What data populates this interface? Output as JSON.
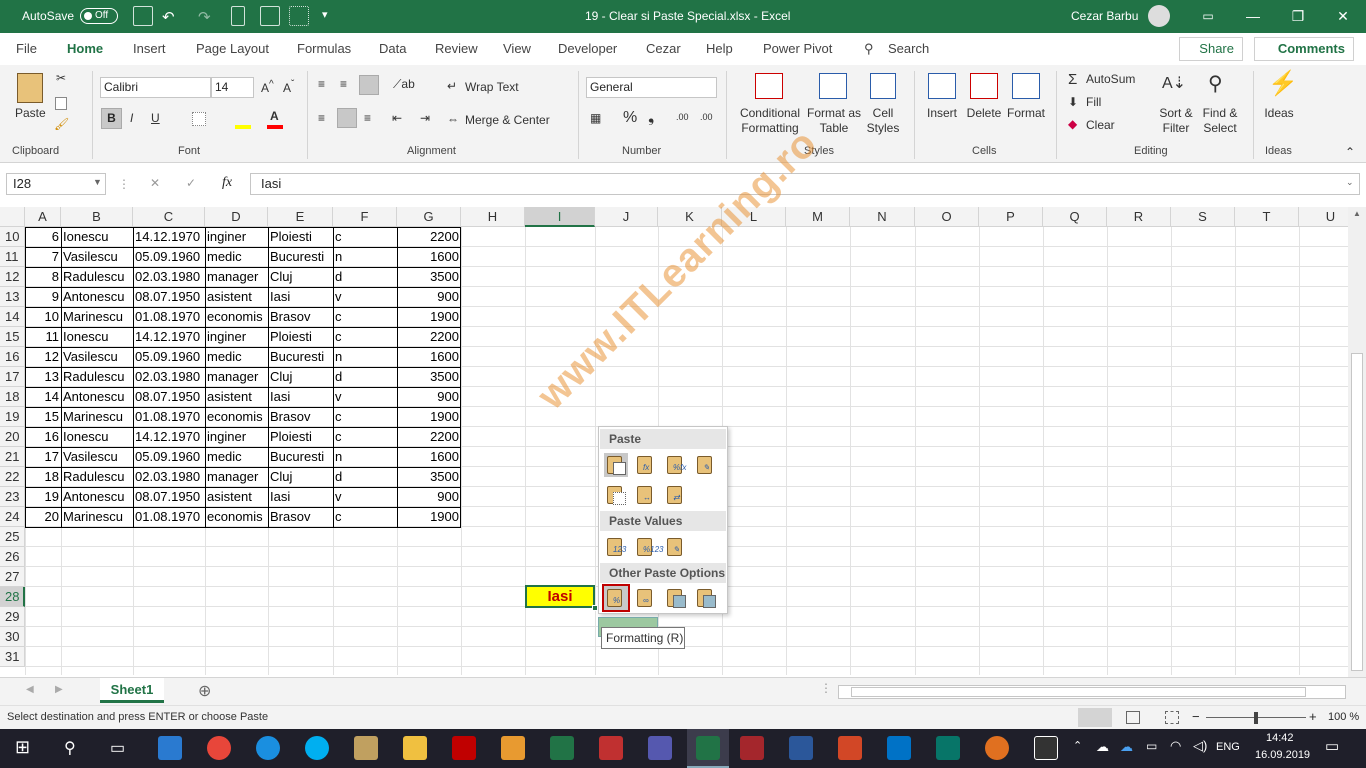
{
  "titlebar": {
    "autosave": "AutoSave",
    "autosave_state": "Off",
    "title": "19 - Clear si Paste Special.xlsx  -  Excel",
    "user": "Cezar Barbu"
  },
  "tabs": [
    "File",
    "Home",
    "Insert",
    "Page Layout",
    "Formulas",
    "Data",
    "Review",
    "View",
    "Developer",
    "Cezar",
    "Help",
    "Power Pivot"
  ],
  "search": "Search",
  "share": "Share",
  "comments": "Comments",
  "ribbon": {
    "paste": "Paste",
    "clipboard": "Clipboard",
    "font_name": "Calibri",
    "font_size": "14",
    "font": "Font",
    "wrap_text": "Wrap Text",
    "merge_center": "Merge & Center",
    "alignment": "Alignment",
    "number_format": "General",
    "number": "Number",
    "conditional": "Conditional",
    "formatting": "Formatting",
    "format_as": "Format as",
    "table": "Table",
    "cell": "Cell",
    "styles_btn": "Styles",
    "styles": "Styles",
    "insert": "Insert",
    "delete": "Delete",
    "format": "Format",
    "cells": "Cells",
    "autosum": "AutoSum",
    "fill": "Fill",
    "clear": "Clear",
    "sort": "Sort &",
    "filter": "Filter",
    "find": "Find &",
    "select": "Select",
    "editing": "Editing",
    "ideas_btn": "Ideas",
    "ideas": "Ideas"
  },
  "namebox": "I28",
  "formula": "Iasi",
  "columns": [
    "A",
    "B",
    "C",
    "D",
    "E",
    "F",
    "G",
    "H",
    "I",
    "J",
    "K",
    "L",
    "M",
    "N",
    "O",
    "P",
    "Q",
    "R",
    "S",
    "T",
    "U"
  ],
  "rows": [
    {
      "n": "10",
      "a": "6",
      "b": "Ionescu",
      "c": "14.12.1970",
      "d": "inginer",
      "e": "Ploiesti",
      "f": "c",
      "g": "2200"
    },
    {
      "n": "11",
      "a": "7",
      "b": "Vasilescu",
      "c": "05.09.1960",
      "d": "medic",
      "e": "Bucuresti",
      "f": "n",
      "g": "1600"
    },
    {
      "n": "12",
      "a": "8",
      "b": "Radulescu",
      "c": "02.03.1980",
      "d": "manager",
      "e": "Cluj",
      "f": "d",
      "g": "3500"
    },
    {
      "n": "13",
      "a": "9",
      "b": "Antonescu",
      "c": "08.07.1950",
      "d": "asistent",
      "e": "Iasi",
      "f": "v",
      "g": "900"
    },
    {
      "n": "14",
      "a": "10",
      "b": "Marinescu",
      "c": "01.08.1970",
      "d": "economis",
      "e": "Brasov",
      "f": "c",
      "g": "1900"
    },
    {
      "n": "15",
      "a": "11",
      "b": "Ionescu",
      "c": "14.12.1970",
      "d": "inginer",
      "e": "Ploiesti",
      "f": "c",
      "g": "2200"
    },
    {
      "n": "16",
      "a": "12",
      "b": "Vasilescu",
      "c": "05.09.1960",
      "d": "medic",
      "e": "Bucuresti",
      "f": "n",
      "g": "1600"
    },
    {
      "n": "17",
      "a": "13",
      "b": "Radulescu",
      "c": "02.03.1980",
      "d": "manager",
      "e": "Cluj",
      "f": "d",
      "g": "3500"
    },
    {
      "n": "18",
      "a": "14",
      "b": "Antonescu",
      "c": "08.07.1950",
      "d": "asistent",
      "e": "Iasi",
      "f": "v",
      "g": "900"
    },
    {
      "n": "19",
      "a": "15",
      "b": "Marinescu",
      "c": "01.08.1970",
      "d": "economis",
      "e": "Brasov",
      "f": "c",
      "g": "1900"
    },
    {
      "n": "20",
      "a": "16",
      "b": "Ionescu",
      "c": "14.12.1970",
      "d": "inginer",
      "e": "Ploiesti",
      "f": "c",
      "g": "2200"
    },
    {
      "n": "21",
      "a": "17",
      "b": "Vasilescu",
      "c": "05.09.1960",
      "d": "medic",
      "e": "Bucuresti",
      "f": "n",
      "g": "1600"
    },
    {
      "n": "22",
      "a": "18",
      "b": "Radulescu",
      "c": "02.03.1980",
      "d": "manager",
      "e": "Cluj",
      "f": "d",
      "g": "3500"
    },
    {
      "n": "23",
      "a": "19",
      "b": "Antonescu",
      "c": "08.07.1950",
      "d": "asistent",
      "e": "Iasi",
      "f": "v",
      "g": "900"
    },
    {
      "n": "24",
      "a": "20",
      "b": "Marinescu",
      "c": "01.08.1970",
      "d": "economis",
      "e": "Brasov",
      "f": "c",
      "g": "1900"
    },
    {
      "n": "25"
    },
    {
      "n": "26"
    },
    {
      "n": "27"
    },
    {
      "n": "28",
      "i": "Iasi"
    },
    {
      "n": "29"
    },
    {
      "n": "30"
    },
    {
      "n": "31"
    }
  ],
  "watermark": "www.ITLearning.ro",
  "pastemenu": {
    "paste": "Paste",
    "paste_values": "Paste Values",
    "other": "Other Paste Options"
  },
  "tooltip": "Formatting (R)",
  "sheet": "Sheet1",
  "status": "Select destination and press ENTER or choose Paste",
  "zoom": "100 %",
  "taskbar": {
    "lang": "ENG",
    "time": "14:42",
    "date": "16.09.2019"
  },
  "colors": {
    "excel_green": "#217346",
    "selected_fill": "#ffff00",
    "selected_text": "#c00000"
  }
}
